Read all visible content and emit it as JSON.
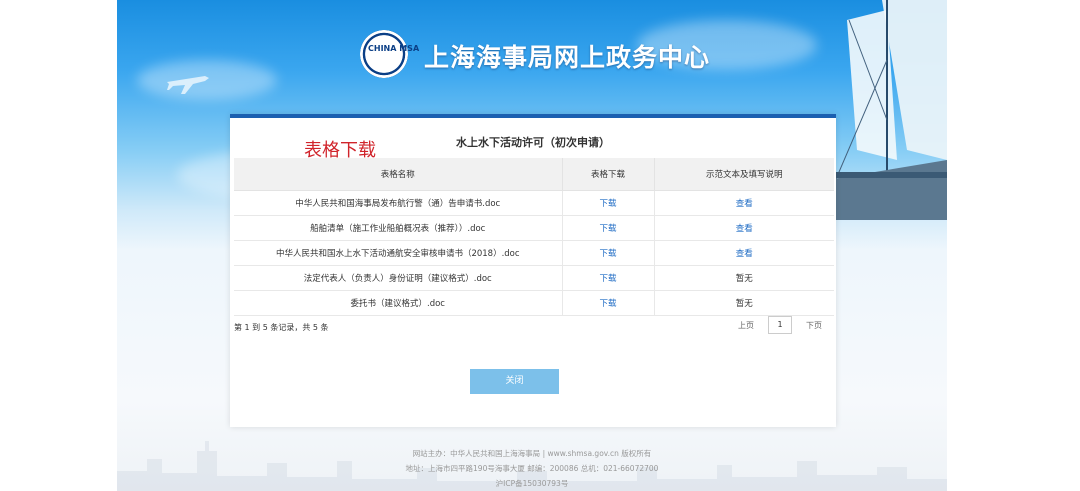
{
  "header": {
    "title": "上海海事局网上政务中心",
    "logo_text": "CHINA MSA"
  },
  "panel": {
    "overlay_label": "表格下载",
    "title": "水上水下活动许可（初次申请）",
    "columns": [
      "表格名称",
      "表格下载",
      "示范文本及填写说明"
    ],
    "rows": [
      {
        "name": "中华人民共和国海事局发布航行警（通）告申请书.doc",
        "download": "下载",
        "sample": "查看",
        "sample_link": true
      },
      {
        "name": "船舶清单（施工作业船舶概况表（推荐））.doc",
        "download": "下载",
        "sample": "查看",
        "sample_link": true
      },
      {
        "name": "中华人民共和国水上水下活动通航安全审核申请书（2018）.doc",
        "download": "下载",
        "sample": "查看",
        "sample_link": true
      },
      {
        "name": "法定代表人（负责人）身份证明（建议格式）.doc",
        "download": "下载",
        "sample": "暂无",
        "sample_link": false
      },
      {
        "name": "委托书（建议格式）.doc",
        "download": "下载",
        "sample": "暂无",
        "sample_link": false
      }
    ],
    "pagination_info": "第 1 到 5 条记录，共 5 条",
    "prev_label": "上页",
    "page_number": "1",
    "next_label": "下页",
    "close_label": "关闭"
  },
  "footer": {
    "line1": "网站主办：中华人民共和国上海海事局 | www.shmsa.gov.cn 版权所有",
    "line2": "地址：上海市四平路190号海事大厦 邮编：200086 总机：021-66072700",
    "line3": "沪ICP备15030793号"
  },
  "colors": {
    "brand_blue": "#1b5fb0",
    "link_blue": "#1e6bc4",
    "overlay_red": "#d0242b",
    "button": "#7cc0ea"
  }
}
